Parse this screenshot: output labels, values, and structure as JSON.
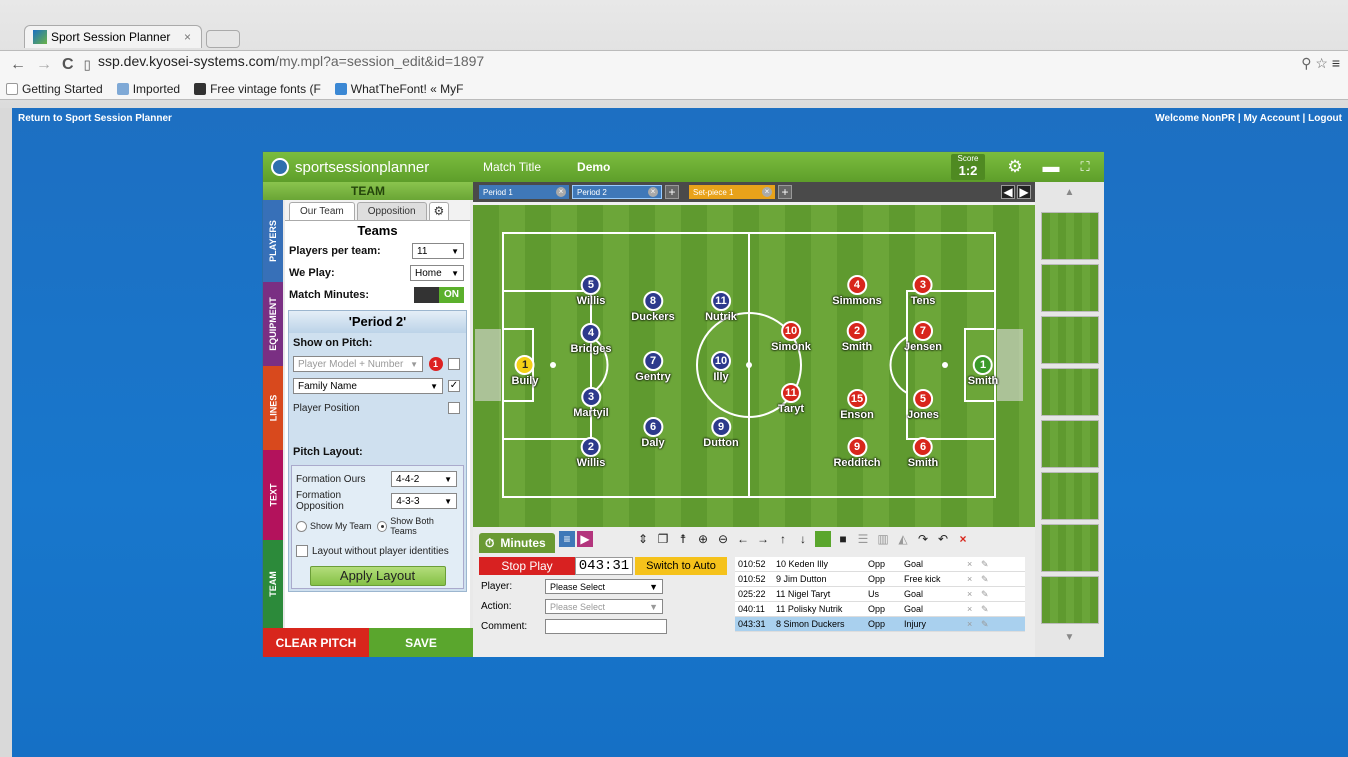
{
  "browser": {
    "tab_title": "Sport Session Planner",
    "url_domain": "ssp.dev.kyosei-systems.com",
    "url_path": "/my.mpl?a=session_edit&id=1897",
    "bookmarks": [
      "Getting Started",
      "Imported",
      "Free vintage fonts (F",
      "WhatTheFont! « MyF"
    ]
  },
  "topbar": {
    "return_link": "Return to Sport Session Planner",
    "welcome": "Welcome NonPR | My Account | Logout"
  },
  "app": {
    "logo": "sportsessionplanner",
    "match_title_label": "Match Title",
    "match_title_value": "Demo",
    "score_label": "Score",
    "score_value": "1:2"
  },
  "left": {
    "header": "TEAM",
    "vtabs": [
      "PLAYERS",
      "EQUIPMENT",
      "LINES",
      "TEXT",
      "TEAM"
    ],
    "tabs": [
      "Our Team",
      "Opposition"
    ],
    "teams_title": "Teams",
    "players_per_team_label": "Players per team:",
    "players_per_team_value": "11",
    "we_play_label": "We Play:",
    "we_play_value": "Home",
    "match_minutes_label": "Match Minutes:",
    "match_minutes_toggle": "ON",
    "period_title": "'Period 2'",
    "show_on_pitch_label": "Show on Pitch:",
    "model_select_placeholder": "Player Model + Number",
    "model_badge": "1",
    "name_select": "Family Name",
    "player_position_label": "Player Position",
    "pitch_layout_label": "Pitch Layout:",
    "formation_ours_label": "Formation Ours",
    "formation_ours_value": "4-4-2",
    "formation_opp_label": "Formation Opposition",
    "formation_opp_value": "4-3-3",
    "show_my_team": "Show My Team",
    "show_both_teams": "Show Both Teams",
    "layout_without": "Layout without player identities",
    "apply_layout": "Apply Layout",
    "clear_pitch": "CLEAR PITCH",
    "save": "SAVE"
  },
  "period_tabs": [
    "Period 1",
    "Period 2",
    "Set-piece 1"
  ],
  "players": [
    {
      "num": "1",
      "name": "Buily",
      "team": "gk-ours"
    },
    {
      "num": "5",
      "name": "Willis",
      "team": "ours"
    },
    {
      "num": "4",
      "name": "Bridges",
      "team": "ours"
    },
    {
      "num": "3",
      "name": "Martyil",
      "team": "ours"
    },
    {
      "num": "2",
      "name": "Willis",
      "team": "ours"
    },
    {
      "num": "8",
      "name": "Duckers",
      "team": "ours"
    },
    {
      "num": "7",
      "name": "Gentry",
      "team": "ours"
    },
    {
      "num": "6",
      "name": "Daly",
      "team": "ours"
    },
    {
      "num": "11",
      "name": "Nutrik",
      "team": "ours"
    },
    {
      "num": "10",
      "name": "Illy",
      "team": "ours"
    },
    {
      "num": "9",
      "name": "Dutton",
      "team": "ours"
    },
    {
      "num": "10",
      "name": "Simonk",
      "team": "opp"
    },
    {
      "num": "11",
      "name": "Taryt",
      "team": "opp"
    },
    {
      "num": "4",
      "name": "Simmons",
      "team": "opp"
    },
    {
      "num": "2",
      "name": "Smith",
      "team": "opp"
    },
    {
      "num": "15",
      "name": "Enson",
      "team": "opp"
    },
    {
      "num": "9",
      "name": "Redditch",
      "team": "opp"
    },
    {
      "num": "3",
      "name": "Tens",
      "team": "opp"
    },
    {
      "num": "7",
      "name": "Jensen",
      "team": "opp"
    },
    {
      "num": "5",
      "name": "Jones",
      "team": "opp"
    },
    {
      "num": "6",
      "name": "Smith",
      "team": "opp"
    },
    {
      "num": "1",
      "name": "Smith",
      "team": "gk-opp"
    }
  ],
  "minutes": {
    "tab": "Minutes",
    "stop": "Stop Play",
    "clock_min": "043",
    "clock_sec": "31",
    "switch": "Switch to Auto",
    "player_label": "Player:",
    "player_value": "Please Select",
    "action_label": "Action:",
    "action_value": "Please Select",
    "comment_label": "Comment:",
    "log": [
      {
        "time": "010:52",
        "who": "10  Keden Illy",
        "side": "Opp",
        "ev": "Goal"
      },
      {
        "time": "010:52",
        "who": "9  Jim Dutton",
        "side": "Opp",
        "ev": "Free kick"
      },
      {
        "time": "025:22",
        "who": "11  Nigel Taryt",
        "side": "Us",
        "ev": "Goal"
      },
      {
        "time": "040:11",
        "who": "11  Polisky Nutrik",
        "side": "Opp",
        "ev": "Goal"
      },
      {
        "time": "043:31",
        "who": "8  Simon Duckers",
        "side": "Opp",
        "ev": "Injury"
      }
    ]
  },
  "colors": {
    "ours": "#2d3a8c",
    "opp": "#d8261c",
    "gk_ours": "#f4d016",
    "gk_opp": "#3a9a2a"
  }
}
